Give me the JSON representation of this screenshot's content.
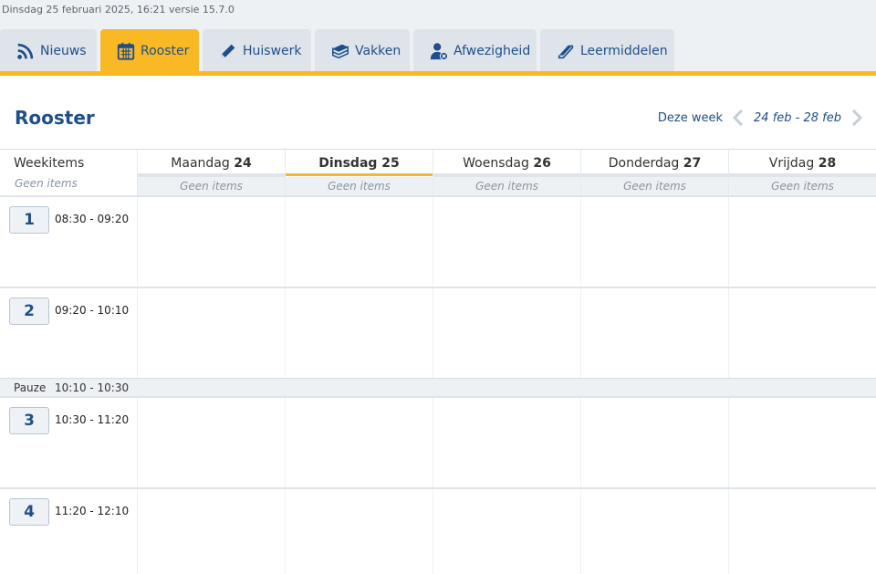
{
  "header": {
    "version_text": "Dinsdag 25 februari 2025, 16:21 versie 15.7.0"
  },
  "tabs": [
    {
      "label": "Nieuws",
      "icon": "rss-icon",
      "active": false
    },
    {
      "label": "Rooster",
      "icon": "calendar-icon",
      "active": true
    },
    {
      "label": "Huiswerk",
      "icon": "pencil-icon",
      "active": false
    },
    {
      "label": "Vakken",
      "icon": "books-icon",
      "active": false
    },
    {
      "label": "Afwezigheid",
      "icon": "user-absent-icon",
      "active": false
    },
    {
      "label": "Leermiddelen",
      "icon": "book-icon",
      "active": false
    }
  ],
  "colors": {
    "accent": "#f9b924",
    "brand": "#1e4f8c",
    "tab_bg": "#dfe4ea"
  },
  "page": {
    "title": "Rooster",
    "this_week": "Deze week",
    "range": "24 feb - 28 feb"
  },
  "schedule": {
    "weekitems_label": "Weekitems",
    "weekitems_empty": "Geen items",
    "days": [
      {
        "name": "Maandag",
        "num": "24",
        "empty": "Geen items",
        "active": false
      },
      {
        "name": "Dinsdag",
        "num": "25",
        "empty": "Geen items",
        "active": true
      },
      {
        "name": "Woensdag",
        "num": "26",
        "empty": "Geen items",
        "active": false
      },
      {
        "name": "Donderdag",
        "num": "27",
        "empty": "Geen items",
        "active": false
      },
      {
        "name": "Vrijdag",
        "num": "28",
        "empty": "Geen items",
        "active": false
      }
    ],
    "periods": [
      {
        "num": "1",
        "time": "08:30 - 09:20"
      },
      {
        "num": "2",
        "time": "09:20 - 10:10"
      },
      {
        "num": "3",
        "time": "10:30 - 11:20"
      },
      {
        "num": "4",
        "time": "11:20 - 12:10"
      }
    ],
    "break": {
      "label": "Pauze",
      "time": "10:10 - 10:30"
    }
  }
}
